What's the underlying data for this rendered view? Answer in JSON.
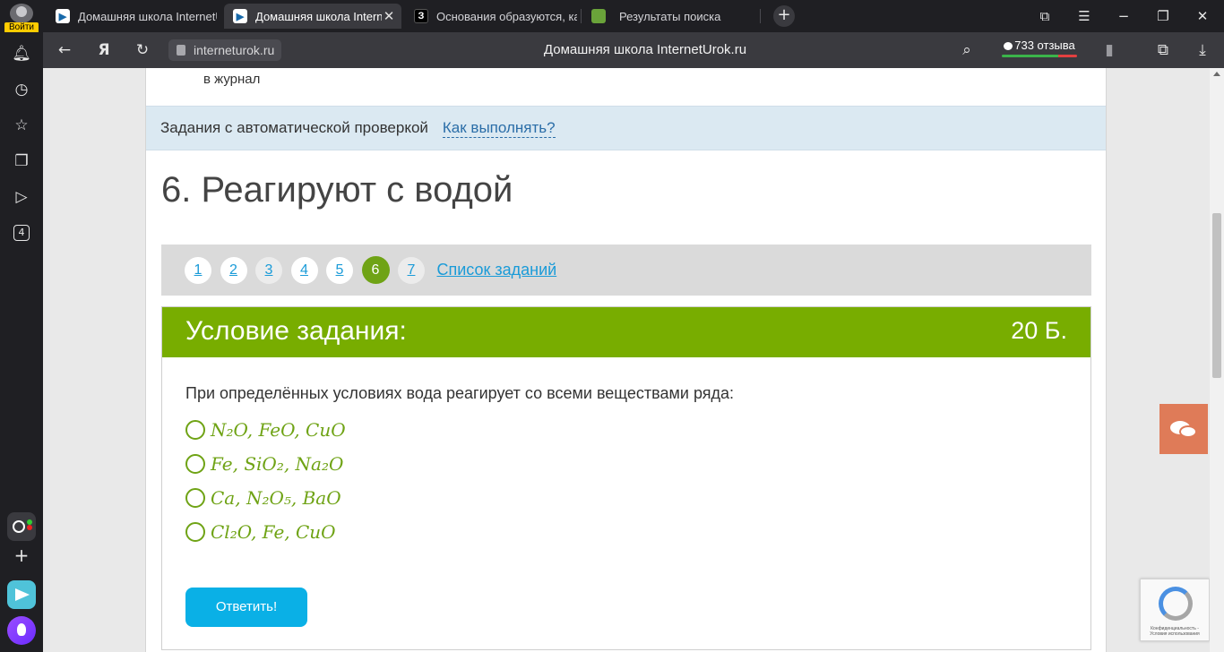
{
  "browser": {
    "login_label": "Войти",
    "tabs": [
      {
        "title": "Домашняя школа InternetUrok.ru",
        "favicon": "iu-icon"
      },
      {
        "title": "Домашняя школа InternetUrok.ru",
        "favicon": "iu-icon"
      },
      {
        "title": "Основания образуются, как...",
        "favicon": "z-icon"
      },
      {
        "title": "Результаты поиска",
        "favicon": "book-icon"
      }
    ],
    "close_glyph": "✕",
    "url": "interneturok.ru",
    "page_title": "Домашняя школа InternetUrok.ru",
    "reviews": "733 отзыва"
  },
  "sidebar": {
    "counter": "4"
  },
  "page": {
    "journal_text": "в журнал",
    "banner": {
      "label": "Задания с автоматической проверкой",
      "link": "Как выполнять?"
    },
    "heading": "6. Реагируют с водой",
    "pager": {
      "items": [
        "1",
        "2",
        "3",
        "4",
        "5",
        "6",
        "7"
      ],
      "current": "6",
      "list_link": "Список заданий"
    },
    "task": {
      "label": "Условие задания:",
      "points": "20 Б.",
      "question": "При определённых условиях вода реагирует со всеми веществами ряда:",
      "options": [
        "N₂O, FeO, CuO",
        "Fe, SiO₂, Na₂O",
        "Ca, N₂O₅, BaO",
        "Cl₂O, Fe, CuO"
      ],
      "submit": "Ответить!"
    },
    "recaptcha_text": "Конфиденциальность - Условия использования"
  },
  "colors": {
    "accent_green": "#78ad00",
    "button_blue": "#0ab0e6",
    "link_blue": "#1a9bd8",
    "chat_widget": "#df7b58"
  }
}
